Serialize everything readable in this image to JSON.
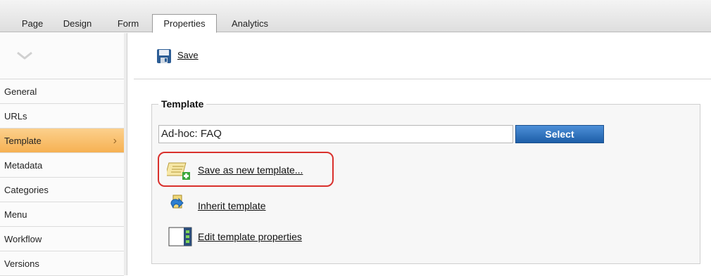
{
  "tabs": [
    {
      "label": "Page",
      "active": false
    },
    {
      "label": "Design",
      "active": false
    },
    {
      "label": "Form",
      "active": false
    },
    {
      "label": "Properties",
      "active": true
    },
    {
      "label": "Analytics",
      "active": false
    }
  ],
  "sidebar": {
    "collapse_icon": "chevron-down-icon",
    "items": [
      {
        "label": "General",
        "active": false
      },
      {
        "label": "URLs",
        "active": false
      },
      {
        "label": "Template",
        "active": true
      },
      {
        "label": "Metadata",
        "active": false
      },
      {
        "label": "Categories",
        "active": false
      },
      {
        "label": "Menu",
        "active": false
      },
      {
        "label": "Workflow",
        "active": false
      },
      {
        "label": "Versions",
        "active": false
      }
    ]
  },
  "toolbar": {
    "save_label": "Save",
    "save_icon": "floppy-disk-icon"
  },
  "template_panel": {
    "legend": "Template",
    "value": "Ad-hoc: FAQ",
    "select_label": "Select",
    "actions": [
      {
        "label": "Save as new template...",
        "icon": "save-template-icon"
      },
      {
        "label": "Inherit template",
        "icon": "inherit-icon"
      },
      {
        "label": "Edit template properties",
        "icon": "template-properties-icon"
      }
    ]
  },
  "colors": {
    "accent_blue": "#2b6fc0",
    "active_orange": "#f6b153",
    "highlight_red": "#d9302c"
  }
}
